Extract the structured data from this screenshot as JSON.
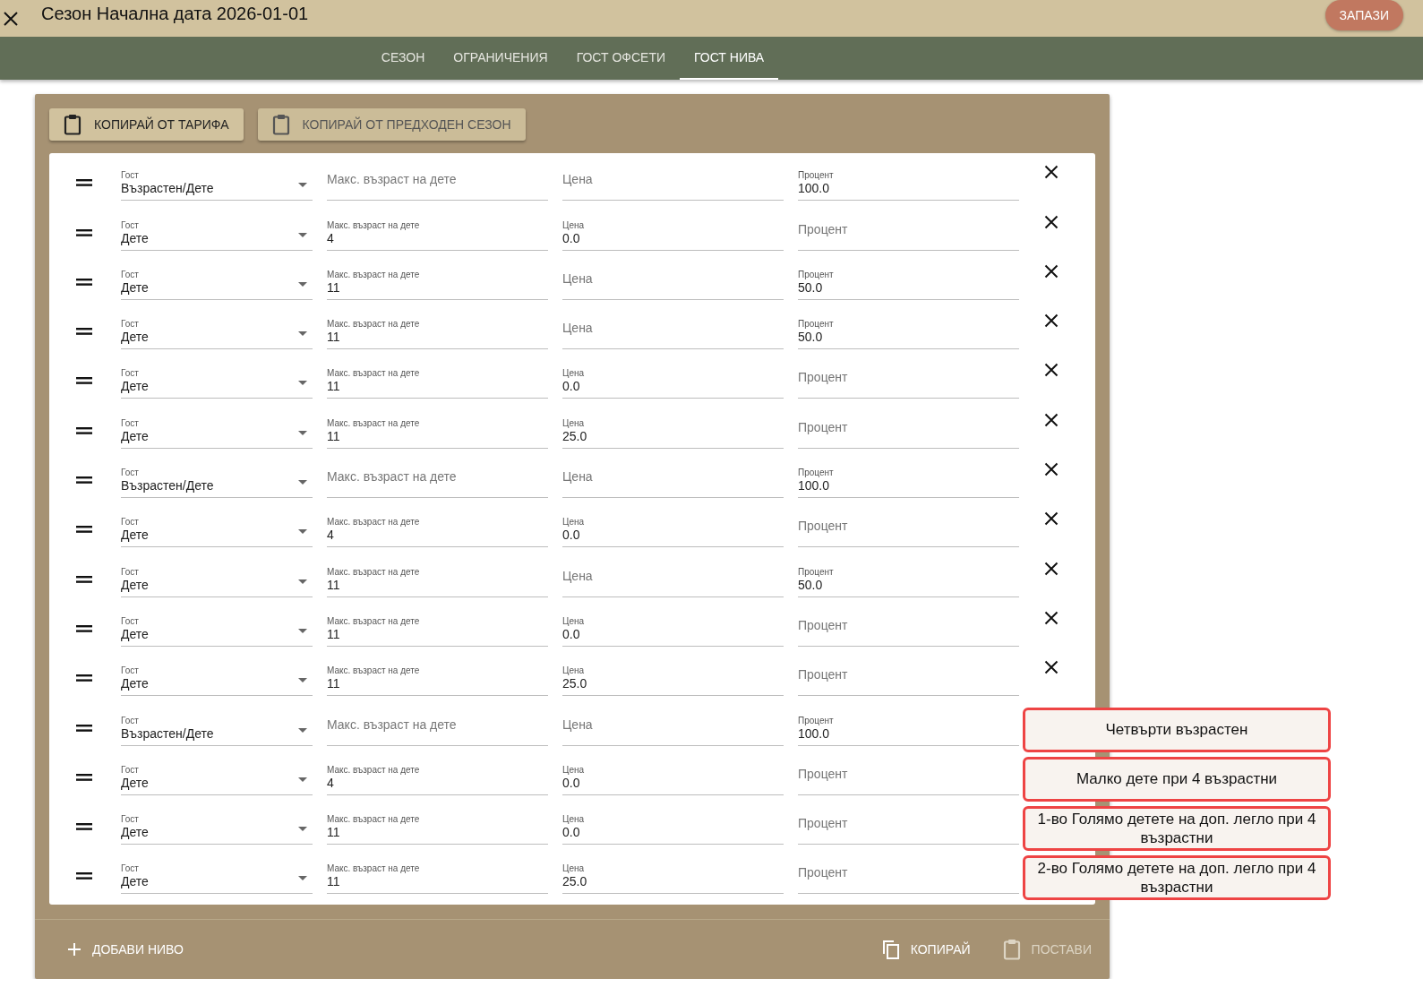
{
  "header": {
    "title": "Сезон Начална дата 2026-01-01",
    "save_button": "ЗАПАЗИ"
  },
  "tabs": [
    {
      "label": "СЕЗОН",
      "selected": false
    },
    {
      "label": "ОГРАНИЧЕНИЯ",
      "selected": false
    },
    {
      "label": "ГОСТ ОФСЕТИ",
      "selected": false
    },
    {
      "label": "ГОСТ НИВА",
      "selected": true
    }
  ],
  "copy_buttons": [
    {
      "label": "КОПИРАЙ ОТ ТАРИФА",
      "disabled": false
    },
    {
      "label": "КОПИРАЙ ОТ ПРЕДХОДЕН СЕЗОН",
      "disabled": true
    }
  ],
  "levels": [
    {
      "guest": {
        "label": "Гост",
        "value": "Възрастен/Дете"
      },
      "max_age": {
        "placeholder": "Макс. възраст на дете"
      },
      "price": {
        "placeholder": "Цена"
      },
      "percent": {
        "label": "Процент",
        "value": "100.0"
      }
    },
    {
      "guest": {
        "label": "Гост",
        "value": "Дете"
      },
      "max_age": {
        "label": "Макс. възраст на дете",
        "value": "4"
      },
      "price": {
        "label": "Цена",
        "value": "0.0"
      },
      "percent": {
        "placeholder": "Процент"
      }
    },
    {
      "guest": {
        "label": "Гост",
        "value": "Дете"
      },
      "max_age": {
        "label": "Макс. възраст на дете",
        "value": "11"
      },
      "price": {
        "placeholder": "Цена"
      },
      "percent": {
        "label": "Процент",
        "value": "50.0"
      }
    },
    {
      "guest": {
        "label": "Гост",
        "value": "Дете"
      },
      "max_age": {
        "label": "Макс. възраст на дете",
        "value": "11"
      },
      "price": {
        "placeholder": "Цена"
      },
      "percent": {
        "label": "Процент",
        "value": "50.0"
      }
    },
    {
      "guest": {
        "label": "Гост",
        "value": "Дете"
      },
      "max_age": {
        "label": "Макс. възраст на дете",
        "value": "11"
      },
      "price": {
        "label": "Цена",
        "value": "0.0"
      },
      "percent": {
        "placeholder": "Процент"
      }
    },
    {
      "guest": {
        "label": "Гост",
        "value": "Дете"
      },
      "max_age": {
        "label": "Макс. възраст на дете",
        "value": "11"
      },
      "price": {
        "label": "Цена",
        "value": "25.0"
      },
      "percent": {
        "placeholder": "Процент"
      }
    },
    {
      "guest": {
        "label": "Гост",
        "value": "Възрастен/Дете"
      },
      "max_age": {
        "placeholder": "Макс. възраст на дете"
      },
      "price": {
        "placeholder": "Цена"
      },
      "percent": {
        "label": "Процент",
        "value": "100.0"
      }
    },
    {
      "guest": {
        "label": "Гост",
        "value": "Дете"
      },
      "max_age": {
        "label": "Макс. възраст на дете",
        "value": "4"
      },
      "price": {
        "label": "Цена",
        "value": "0.0"
      },
      "percent": {
        "placeholder": "Процент"
      }
    },
    {
      "guest": {
        "label": "Гост",
        "value": "Дете"
      },
      "max_age": {
        "label": "Макс. възраст на дете",
        "value": "11"
      },
      "price": {
        "placeholder": "Цена"
      },
      "percent": {
        "label": "Процент",
        "value": "50.0"
      }
    },
    {
      "guest": {
        "label": "Гост",
        "value": "Дете"
      },
      "max_age": {
        "label": "Макс. възраст на дете",
        "value": "11"
      },
      "price": {
        "label": "Цена",
        "value": "0.0"
      },
      "percent": {
        "placeholder": "Процент"
      }
    },
    {
      "guest": {
        "label": "Гост",
        "value": "Дете"
      },
      "max_age": {
        "label": "Макс. възраст на дете",
        "value": "11"
      },
      "price": {
        "label": "Цена",
        "value": "25.0"
      },
      "percent": {
        "placeholder": "Процент"
      }
    },
    {
      "guest": {
        "label": "Гост",
        "value": "Възрастен/Дете"
      },
      "max_age": {
        "placeholder": "Макс. възраст на дете"
      },
      "price": {
        "placeholder": "Цена"
      },
      "percent": {
        "label": "Процент",
        "value": "100.0"
      },
      "callout": "Четвърти възрастен"
    },
    {
      "guest": {
        "label": "Гост",
        "value": "Дете"
      },
      "max_age": {
        "label": "Макс. възраст на дете",
        "value": "4"
      },
      "price": {
        "label": "Цена",
        "value": "0.0"
      },
      "percent": {
        "placeholder": "Процент"
      },
      "callout": "Малко дете при 4 възрастни"
    },
    {
      "guest": {
        "label": "Гост",
        "value": "Дете"
      },
      "max_age": {
        "label": "Макс. възраст на дете",
        "value": "11"
      },
      "price": {
        "label": "Цена",
        "value": "0.0"
      },
      "percent": {
        "placeholder": "Процент"
      },
      "callout": "1-во Голямо детете на доп. легло при 4 възрастни"
    },
    {
      "guest": {
        "label": "Гост",
        "value": "Дете"
      },
      "max_age": {
        "label": "Макс. възраст на дете",
        "value": "11"
      },
      "price": {
        "label": "Цена",
        "value": "25.0"
      },
      "percent": {
        "placeholder": "Процент"
      },
      "callout": "2-во Голямо детете на доп. легло при 4 възрастни"
    }
  ],
  "footer": {
    "add_button": "ДОБАВИ НИВО",
    "copy_button": {
      "label": "КОПИРАЙ",
      "disabled": false
    },
    "paste_button": {
      "label": "ПОСТАВИ",
      "disabled": true
    }
  }
}
